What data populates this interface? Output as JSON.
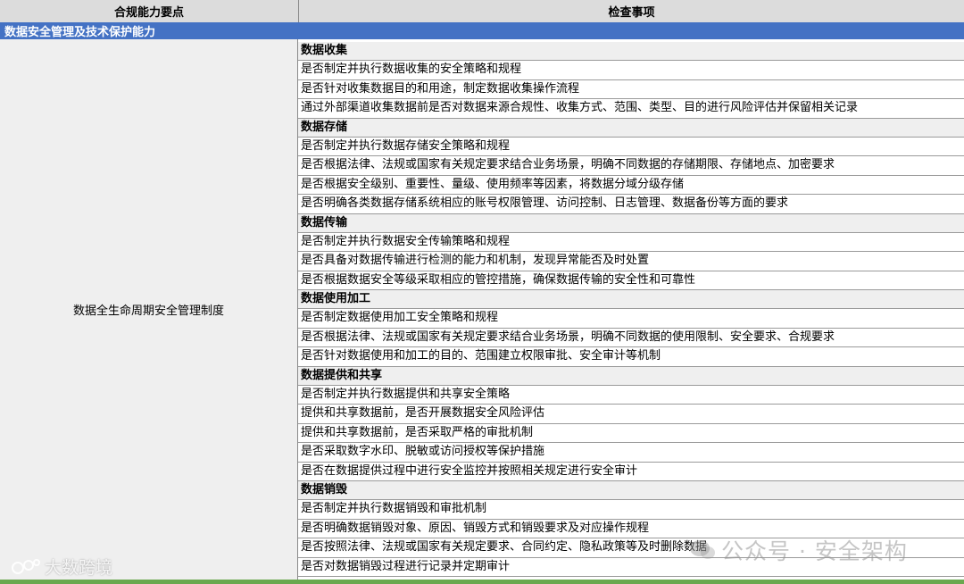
{
  "header": {
    "col1": "合规能力要点",
    "col2": "检查事项"
  },
  "section_title": "数据安全管理及技术保护能力",
  "left_cell": "数据全生命周期安全管理制度",
  "rows": [
    {
      "text": "数据收集",
      "category": true
    },
    {
      "text": "是否制定并执行数据收集的安全策略和规程",
      "category": false
    },
    {
      "text": "是否针对收集数据目的和用途，制定数据收集操作流程",
      "category": false
    },
    {
      "text": "通过外部渠道收集数据前是否对数据来源合规性、收集方式、范围、类型、目的进行风险评估并保留相关记录",
      "category": false
    },
    {
      "text": "数据存储",
      "category": true
    },
    {
      "text": "是否制定并执行数据存储安全策略和规程",
      "category": false
    },
    {
      "text": "是否根据法律、法规或国家有关规定要求结合业务场景，明确不同数据的存储期限、存储地点、加密要求",
      "category": false
    },
    {
      "text": "是否根据安全级别、重要性、量级、使用频率等因素，将数据分域分级存储",
      "category": false
    },
    {
      "text": "是否明确各类数据存储系统相应的账号权限管理、访问控制、日志管理、数据备份等方面的要求",
      "category": false
    },
    {
      "text": "数据传输",
      "category": true
    },
    {
      "text": "是否制定并执行数据安全传输策略和规程",
      "category": false
    },
    {
      "text": "是否具备对数据传输进行检测的能力和机制，发现异常能否及时处置",
      "category": false
    },
    {
      "text": "是否根据数据安全等级采取相应的管控措施，确保数据传输的安全性和可靠性",
      "category": false
    },
    {
      "text": "数据使用加工",
      "category": true
    },
    {
      "text": "是否制定数据使用加工安全策略和规程",
      "category": false
    },
    {
      "text": "是否根据法律、法规或国家有关规定要求结合业务场景，明确不同数据的使用限制、安全要求、合规要求",
      "category": false
    },
    {
      "text": "是否针对数据使用和加工的目的、范围建立权限审批、安全审计等机制",
      "category": false
    },
    {
      "text": "数据提供和共享",
      "category": true
    },
    {
      "text": "是否制定并执行数据提供和共享安全策略",
      "category": false
    },
    {
      "text": "提供和共享数据前，是否开展数据安全风险评估",
      "category": false
    },
    {
      "text": "提供和共享数据前，是否采取严格的审批机制",
      "category": false
    },
    {
      "text": "是否采取数字水印、脱敏或访问授权等保护措施",
      "category": false
    },
    {
      "text": "是否在数据提供过程中进行安全监控并按照相关规定进行安全审计",
      "category": false
    },
    {
      "text": "数据销毁",
      "category": true
    },
    {
      "text": "是否制定并执行数据销毁和审批机制",
      "category": false
    },
    {
      "text": "是否明确数据销毁对象、原因、销毁方式和销毁要求及对应操作规程",
      "category": false
    },
    {
      "text": "是否按照法律、法规或国家有关规定要求、合同约定、隐私政策等及时删除数据",
      "category": false
    },
    {
      "text": "是否对数据销毁过程进行记录并定期审计",
      "category": false
    }
  ],
  "watermark_left": "大数跨境",
  "watermark_right": "公众号 · 安全架构"
}
